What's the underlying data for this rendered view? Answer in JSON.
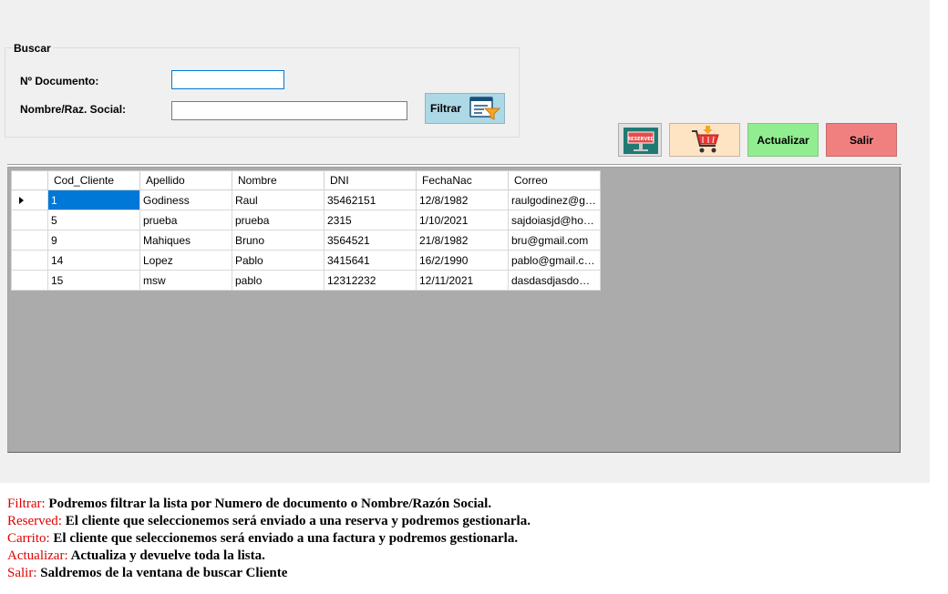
{
  "search": {
    "group_title": "Buscar",
    "doc_label": "Nº Documento:",
    "doc_value": "",
    "name_label": "Nombre/Raz. Social:",
    "name_value": "",
    "filter_label": "Filtrar"
  },
  "toolbar": {
    "reserved_icon_text": "RESERVED",
    "actualizar_label": "Actualizar",
    "salir_label": "Salir",
    "colors": {
      "filtrar": "#add8e6",
      "carrito": "#ffe4c4",
      "actualizar": "#90ee90",
      "salir": "#f08080"
    }
  },
  "grid": {
    "columns": [
      "Cod_Cliente",
      "Apellido",
      "Nombre",
      "DNI",
      "FechaNac",
      "Correo"
    ],
    "rows": [
      [
        "1",
        "Godiness",
        "Raul",
        "35462151",
        "12/8/1982",
        "raulgodinez@gm..."
      ],
      [
        "5",
        "prueba",
        "prueba",
        "2315",
        "1/10/2021",
        "sajdoiasjd@hotmail"
      ],
      [
        "9",
        "Mahiques",
        "Bruno",
        "3564521",
        "21/8/1982",
        "bru@gmail.com"
      ],
      [
        "14",
        "Lopez",
        "Pablo",
        "3415641",
        "16/2/1990",
        "pablo@gmail.com"
      ],
      [
        "15",
        "msw",
        "pablo",
        "12312232",
        "12/11/2021",
        "dasdasdjasdo@g..."
      ]
    ]
  },
  "notes": [
    {
      "key": "Filtrar:",
      "text": " Podremos filtrar la lista por Numero de documento o Nombre/Razón Social."
    },
    {
      "key": "Reserved:",
      "text": " El cliente que seleccionemos será enviado a una reserva y podremos gestionarla."
    },
    {
      "key": "Carrito:",
      "text": "  El cliente que seleccionemos será enviado a una factura y podremos gestionarla."
    },
    {
      "key": "Actualizar:",
      "text": " Actualiza y devuelve toda la lista."
    },
    {
      "key": "Salir:",
      "text": " Saldremos de la ventana de buscar Cliente"
    }
  ]
}
